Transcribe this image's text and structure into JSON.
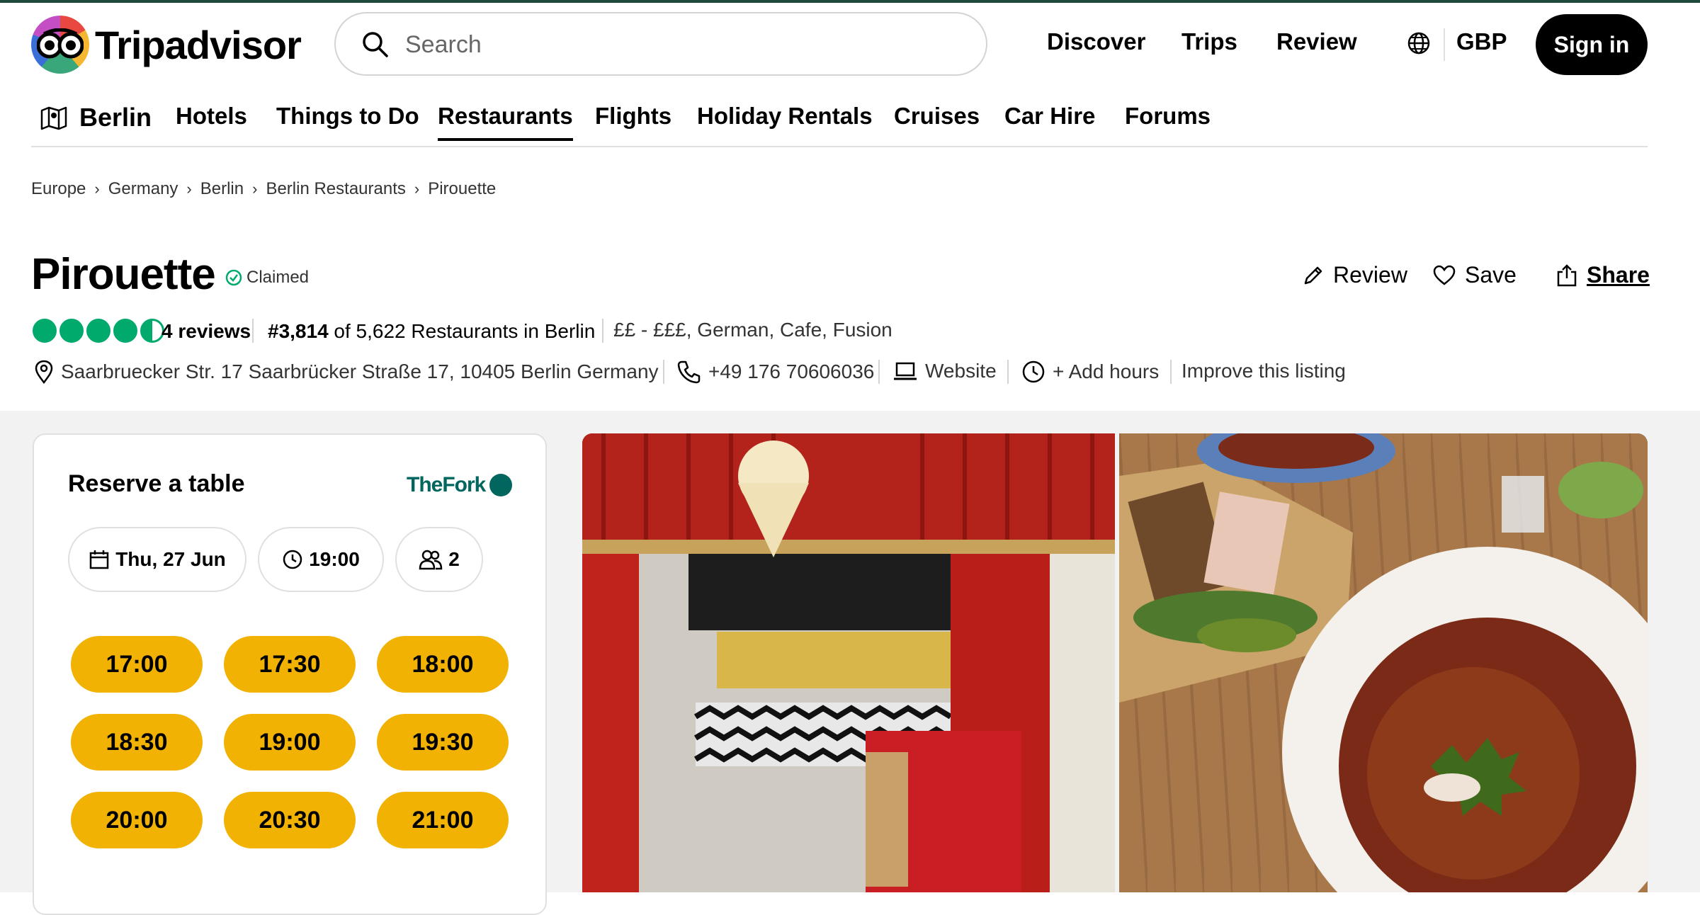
{
  "header": {
    "brand": "Tripadvisor",
    "search_placeholder": "Search",
    "nav": {
      "discover": "Discover",
      "trips": "Trips",
      "review": "Review"
    },
    "currency": "GBP",
    "sign_in": "Sign in"
  },
  "secondary_nav": {
    "city": "Berlin",
    "items": [
      "Hotels",
      "Things to Do",
      "Restaurants",
      "Flights",
      "Holiday Rentals",
      "Cruises",
      "Car Hire",
      "Forums"
    ],
    "active": "Restaurants"
  },
  "breadcrumb": [
    "Europe",
    "Germany",
    "Berlin",
    "Berlin Restaurants",
    "Pirouette"
  ],
  "restaurant": {
    "name": "Pirouette",
    "claimed": "Claimed",
    "rating": 4.5,
    "reviews": "4 reviews",
    "rank": "#3,814",
    "rank_rest": "of 5,622 Restaurants in Berlin",
    "cuisine": "££ - £££, German, Cafe, Fusion",
    "address": "Saarbruecker Str. 17 Saarbrücker Straße 17, 10405 Berlin Germany",
    "phone": "+49 176 70606036",
    "website": "Website",
    "add_hours": "+ Add hours",
    "improve": "Improve this listing"
  },
  "actions": {
    "review": "Review",
    "save": "Save",
    "share": "Share"
  },
  "reserve": {
    "title": "Reserve a table",
    "partner": "TheFork",
    "date": "Thu, 27 Jun",
    "time": "19:00",
    "guests": "2",
    "slots": [
      "17:00",
      "17:30",
      "18:00",
      "18:30",
      "19:00",
      "19:30",
      "20:00",
      "20:30",
      "21:00"
    ]
  },
  "colors": {
    "accent_green": "#00aa6c",
    "slot_yellow": "#f2b203",
    "thefork": "#00665e"
  },
  "icons": [
    "search-icon",
    "globe-icon",
    "map-icon",
    "pencil-icon",
    "heart-icon",
    "share-icon",
    "location-pin-icon",
    "phone-icon",
    "laptop-icon",
    "clock-icon",
    "calendar-icon",
    "people-icon",
    "check-badge-icon"
  ]
}
